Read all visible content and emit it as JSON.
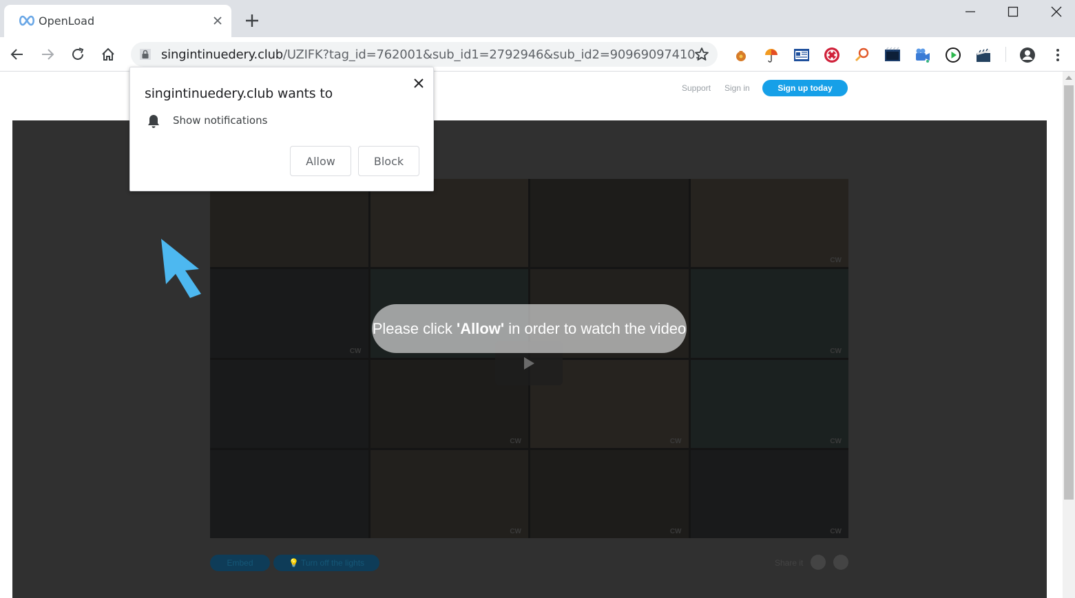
{
  "browser": {
    "tab": {
      "title": "OpenLoad"
    },
    "omnibox": {
      "domain": "singintinuedery.club",
      "path": "/UZIFK?tag_id=762001&sub_id1=2792946&sub_id2=90969097410..."
    }
  },
  "site": {
    "header": {
      "support": "Support",
      "signin": "Sign in",
      "signup": "Sign up today"
    },
    "player": {
      "message_prefix": "Please click ",
      "message_highlight": "'Allow'",
      "message_suffix": " in order to watch the video",
      "watermark": "CW"
    },
    "buttons": {
      "embed": "Embed",
      "lights": "💡 Turn off the lights"
    },
    "share_label": "Share it"
  },
  "popup": {
    "title": "singintinuedery.club wants to",
    "permission": "Show notifications",
    "allow": "Allow",
    "block": "Block"
  },
  "colors": {
    "accent": "#16a0e8",
    "arrow": "#4db8f0"
  }
}
